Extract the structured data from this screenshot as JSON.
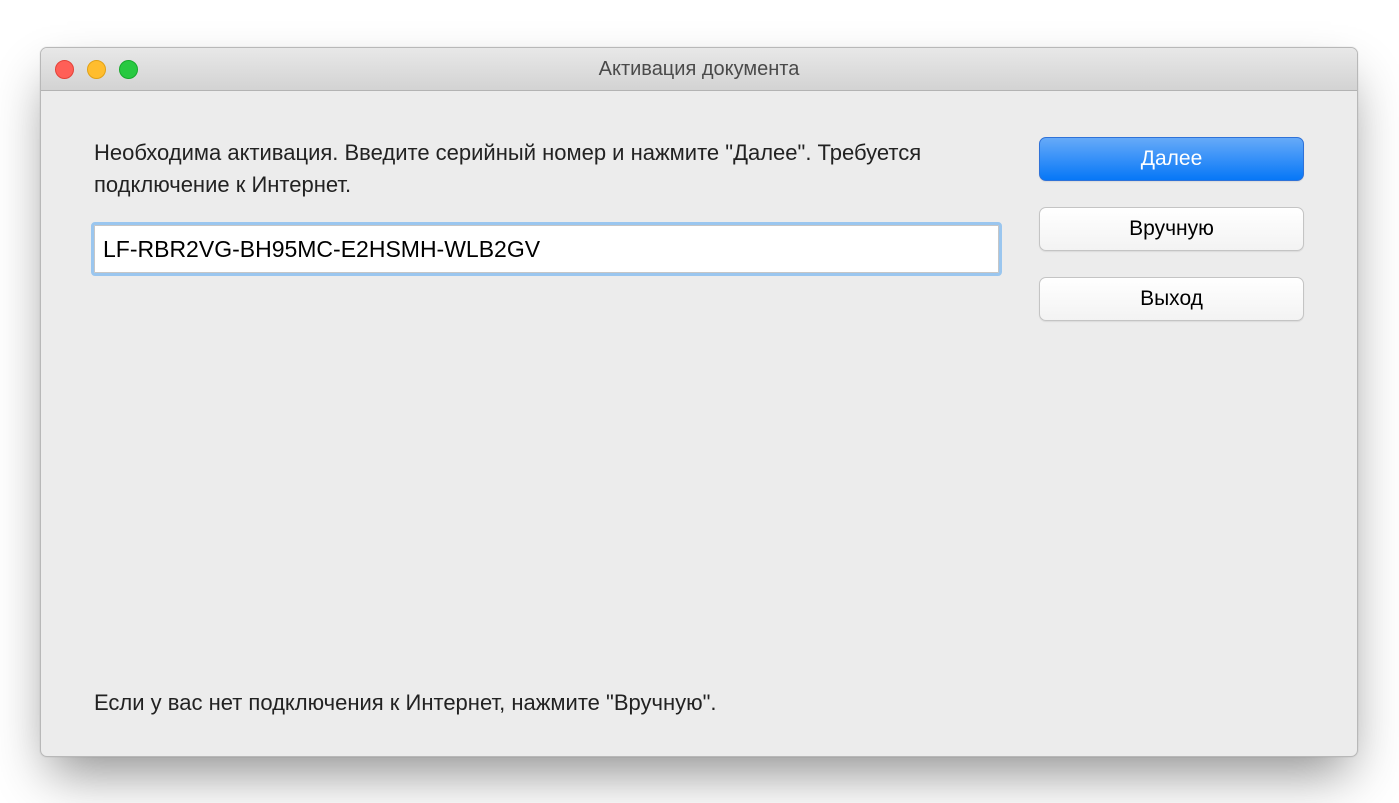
{
  "window": {
    "title": "Активация документа"
  },
  "body": {
    "instructions": "Необходима активация. Введите серийный номер и нажмите \"Далее\". Требуется подключение к Интернет.",
    "serial_value": "LF-RBR2VG-BH95MC-E2HSMH-WLB2GV",
    "footer": "Если у вас нет подключения к Интернет, нажмите \"Вручную\"."
  },
  "buttons": {
    "next": "Далее",
    "manual": "Вручную",
    "exit": "Выход"
  }
}
